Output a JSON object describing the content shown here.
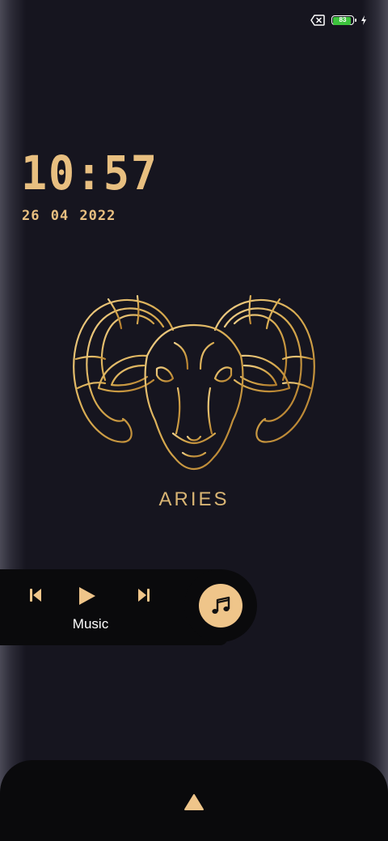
{
  "status_bar": {
    "battery_level": "83",
    "icons": [
      "sim-off-icon",
      "battery-icon",
      "charging-icon"
    ],
    "battery_color": "#3dc43d"
  },
  "lockscreen": {
    "time": "10:57",
    "date": "26 04 2022",
    "accent_color": "#e8bf80"
  },
  "zodiac": {
    "name": "ARIES",
    "icon": "ram-head-icon"
  },
  "music_widget": {
    "label": "Music",
    "controls": [
      "previous-icon",
      "play-icon",
      "next-icon"
    ],
    "disc_icon": "music-note-icon"
  },
  "bottom_panel": {
    "icon": "up-arrow-icon"
  }
}
